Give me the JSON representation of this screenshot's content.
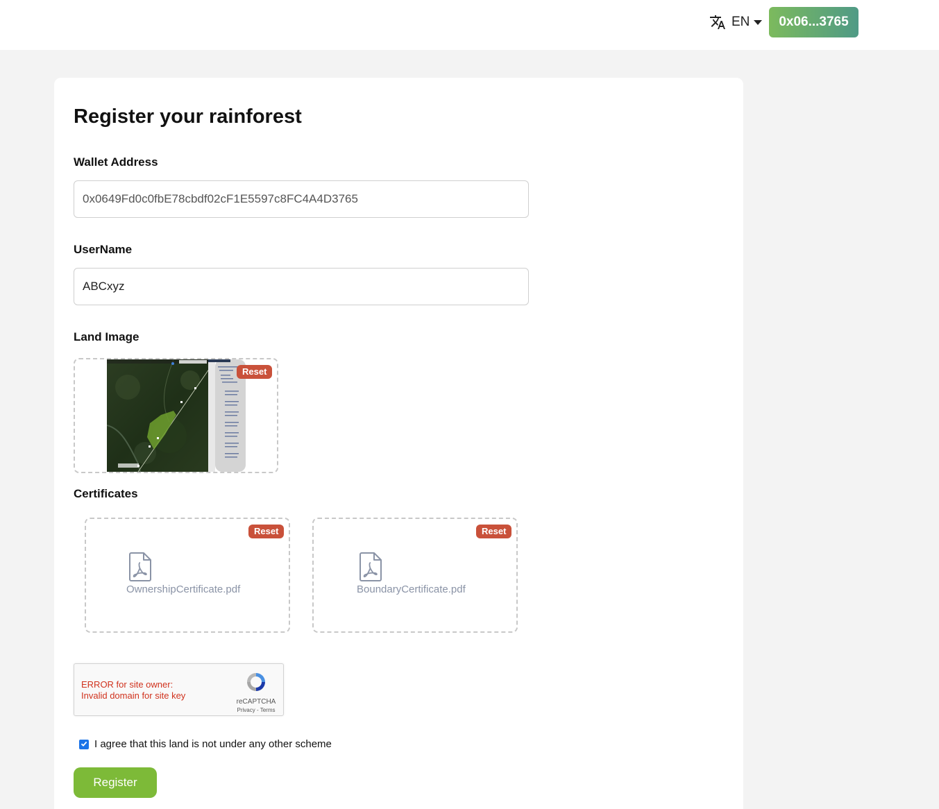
{
  "header": {
    "language": "EN",
    "wallet_short": "0x06...3765",
    "wallet_button_color": "#6aae6f"
  },
  "form": {
    "title": "Register your rainforest",
    "wallet_label": "Wallet Address",
    "wallet_value": "0x0649Fd0c0fbE78cbdf02cF1E5597c8FC4A4D3765",
    "username_label": "UserName",
    "username_value": "ABCxyz",
    "land_image_label": "Land Image",
    "certificates_label": "Certificates",
    "reset_label": "Reset",
    "certificates": [
      {
        "file_name": "OwnershipCertificate.pdf"
      },
      {
        "file_name": "BoundaryCertificate.pdf"
      }
    ],
    "captcha": {
      "error_line1": "ERROR for site owner:",
      "error_line2": "Invalid domain for site key",
      "brand": "reCAPTCHA",
      "links": "Privacy - Terms"
    },
    "agree_text": "I agree that this land is not under any other scheme",
    "agree_checked": true,
    "register_label": "Register"
  },
  "colors": {
    "reset": "#c9513a",
    "register": "#7dba38",
    "checkbox": "#1a73e8"
  },
  "icons": [
    "translate-icon",
    "caret-down-icon",
    "pdf-file-icon",
    "recaptcha-icon",
    "check-icon"
  ]
}
